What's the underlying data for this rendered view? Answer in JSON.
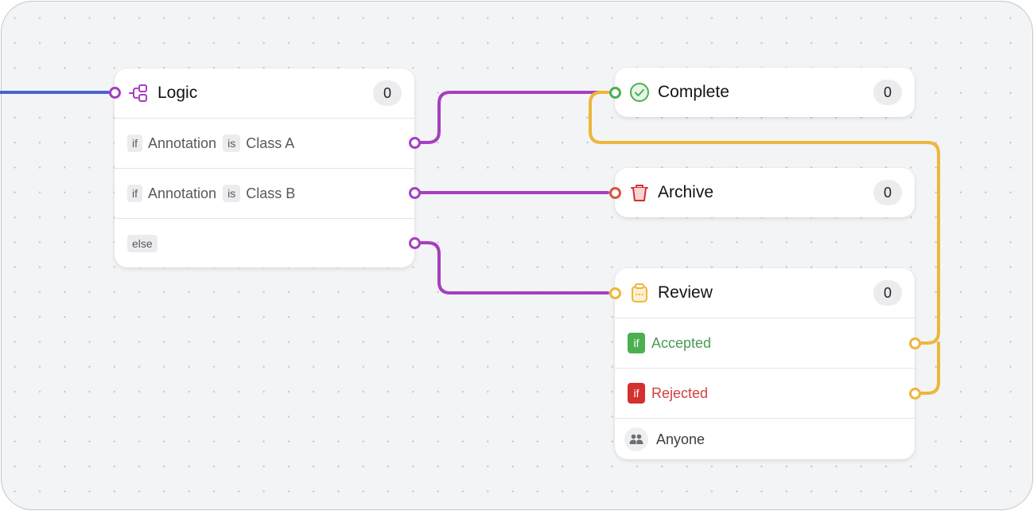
{
  "colors": {
    "input_wire": "#4a62d0",
    "logic_purple": "#a63fbf",
    "complete_green": "#4caf50",
    "archive_red": "#d9533a",
    "review_yellow": "#ecb73a",
    "accepted_text": "#4a9c54",
    "accepted_badge": "#4caf50",
    "rejected_text": "#d04040",
    "rejected_badge": "#d3302f"
  },
  "logic_node": {
    "icon": "logic-branch-icon",
    "title": "Logic",
    "count": "0",
    "rules": [
      {
        "keyword": "if",
        "field": "Annotation",
        "operator": "is",
        "value": "Class A"
      },
      {
        "keyword": "if",
        "field": "Annotation",
        "operator": "is",
        "value": "Class B"
      },
      {
        "keyword": "else"
      }
    ]
  },
  "complete_node": {
    "icon": "check-circle-icon",
    "title": "Complete",
    "count": "0"
  },
  "archive_node": {
    "icon": "trash-icon",
    "title": "Archive",
    "count": "0"
  },
  "review_node": {
    "icon": "clipboard-icon",
    "title": "Review",
    "count": "0",
    "outcomes": [
      {
        "keyword": "if",
        "label": "Accepted"
      },
      {
        "keyword": "if",
        "label": "Rejected"
      }
    ],
    "assignee": {
      "icon": "users-icon",
      "label": "Anyone"
    }
  },
  "connections": [
    {
      "from": "input",
      "to": "Logic"
    },
    {
      "from": "Logic: Class A",
      "to": "Complete"
    },
    {
      "from": "Logic: Class B",
      "to": "Archive"
    },
    {
      "from": "Logic: else",
      "to": "Review"
    },
    {
      "from": "Review: Accepted",
      "to": "Complete"
    },
    {
      "from": "Review: Rejected",
      "to": "Complete"
    }
  ]
}
